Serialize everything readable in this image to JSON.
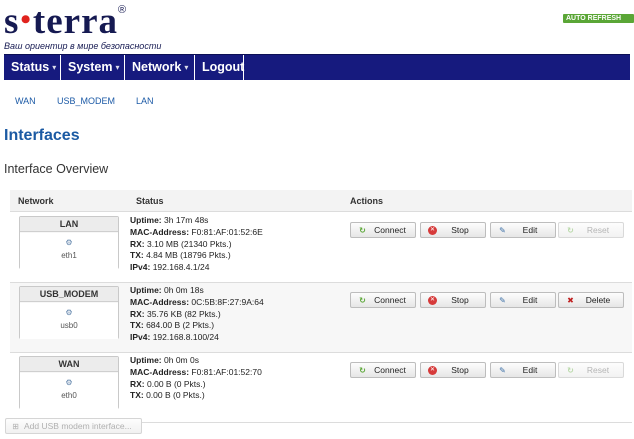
{
  "header": {
    "logo_left": "s",
    "logo_right": "terra",
    "logo_reg": "®",
    "tagline": "Ваш ориентир в мире безопасности",
    "autorefresh": "AUTO REFRESH ON"
  },
  "nav": {
    "items": [
      {
        "label": "Status",
        "caret": "▾"
      },
      {
        "label": "System",
        "caret": "▾"
      },
      {
        "label": "Network",
        "caret": "▾"
      },
      {
        "label": "Logout",
        "caret": ""
      }
    ]
  },
  "subnav": {
    "items": [
      "WAN",
      "USB_MODEM",
      "LAN"
    ]
  },
  "page": {
    "title": "Interfaces",
    "section": "Interface Overview"
  },
  "table": {
    "headers": {
      "network": "Network",
      "status": "Status",
      "actions": "Actions"
    },
    "rows": [
      {
        "name": "LAN",
        "device": "eth1",
        "lines": [
          {
            "k": "Uptime:",
            "v": "3h 17m 48s"
          },
          {
            "k": "MAC-Address:",
            "v": "F0:81:AF:01:52:6E"
          },
          {
            "k": "RX:",
            "v": "3.10 MB (21340 Pkts.)"
          },
          {
            "k": "TX:",
            "v": "4.84 MB (18796 Pkts.)"
          },
          {
            "k": "IPv4:",
            "v": "192.168.4.1/24"
          }
        ],
        "last_button": "Reset",
        "last_enabled": false
      },
      {
        "name": "USB_MODEM",
        "device": "usb0",
        "lines": [
          {
            "k": "Uptime:",
            "v": "0h 0m 18s"
          },
          {
            "k": "MAC-Address:",
            "v": "0C:5B:8F:27:9A:64"
          },
          {
            "k": "RX:",
            "v": "35.76 KB (82 Pkts.)"
          },
          {
            "k": "TX:",
            "v": "684.00 B (2 Pkts.)"
          },
          {
            "k": "IPv4:",
            "v": "192.168.8.100/24"
          }
        ],
        "last_button": "Delete",
        "last_enabled": true
      },
      {
        "name": "WAN",
        "device": "eth0",
        "lines": [
          {
            "k": "Uptime:",
            "v": "0h 0m 0s"
          },
          {
            "k": "MAC-Address:",
            "v": "F0:81:AF:01:52:70"
          },
          {
            "k": "RX:",
            "v": "0.00 B (0 Pkts.)"
          },
          {
            "k": "TX:",
            "v": "0.00 B (0 Pkts.)"
          }
        ],
        "last_button": "Reset",
        "last_enabled": false
      }
    ],
    "buttons": {
      "connect": "Connect",
      "stop": "Stop",
      "edit": "Edit"
    }
  },
  "add_button": "Add USB modem interface...",
  "icons": {
    "connect": "connect-icon",
    "stop": "stop-icon",
    "edit": "edit-icon",
    "delete": "delete-icon",
    "interface": "network-interface-icon"
  },
  "colors": {
    "nav_bg": "#161a7e",
    "title": "#1b5aa3",
    "link": "#1c5aa6",
    "autorefresh": "#5aa636",
    "logo_dot": "#e0231e"
  }
}
